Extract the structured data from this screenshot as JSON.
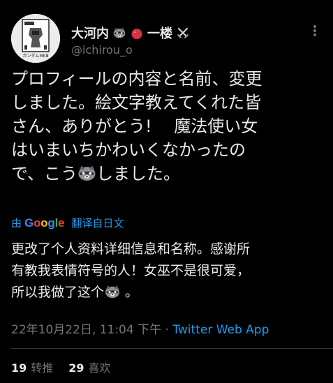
{
  "author": {
    "display_name": "大河内",
    "name_suffix": "一楼",
    "handle": "@ichirou_o",
    "avatar_caption": "ガンダムMKⅢ"
  },
  "tweet": {
    "line1": "プロフィールの内容と名前、変更",
    "line2": "しました。絵文字教えてくれた皆",
    "line3": "さん、ありがとう!　 魔法使い女",
    "line4": "はいまいちかわいくなかったの",
    "line5a": "で、こう",
    "line5b": "しました。"
  },
  "translation": {
    "by": "由",
    "provider": "Google",
    "action": "翻译自日文",
    "line1": "更改了个人资料详细信息和名称。感谢所",
    "line2": "有教我表情符号的人！女巫不是很可爱，",
    "line3a": "所以我做了这个",
    "line3b": " 。"
  },
  "meta": {
    "timestamp": "22年10月22日, 11:04 下午",
    "separator": " · ",
    "source": "Twitter Web App"
  },
  "stats": {
    "retweets_count": "19",
    "retweets_label": "转推",
    "likes_count": "29",
    "likes_label": "喜欢"
  },
  "icons": {
    "name_emojis": [
      "raccoon-icon",
      "tomato-icon",
      "crossed-swords-icon"
    ],
    "inline_emoji": "raccoon-icon",
    "more": "more-icon"
  },
  "colors": {
    "background": "#000000",
    "text": "#e7e9ea",
    "secondary": "#71767b",
    "link": "#1d9bf0"
  }
}
